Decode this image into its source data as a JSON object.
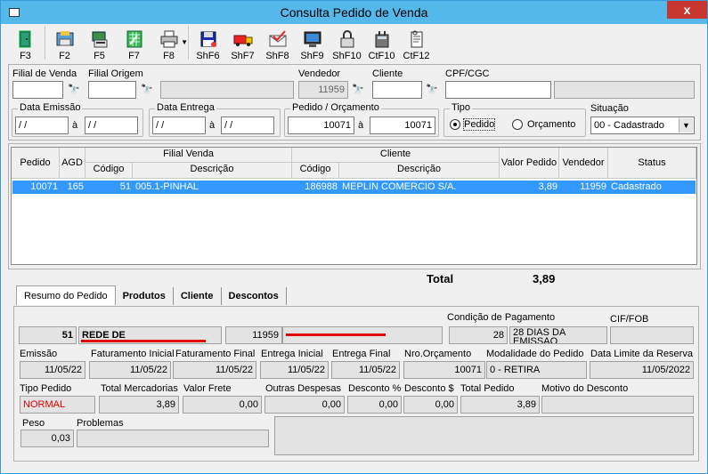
{
  "window": {
    "title": "Consulta Pedido de Venda",
    "close": "x"
  },
  "toolbar": [
    {
      "key": "F3",
      "icon": "exit-door-icon"
    },
    {
      "key": "F2",
      "icon": "save-icon"
    },
    {
      "key": "F5",
      "icon": "copy-icon"
    },
    {
      "key": "F7",
      "icon": "spreadsheet-icon"
    },
    {
      "key": "F8",
      "icon": "printer-icon"
    },
    {
      "key": "ShF6",
      "icon": "floppy-icon"
    },
    {
      "key": "ShF7",
      "icon": "truck-icon"
    },
    {
      "key": "ShF8",
      "icon": "email-check-icon"
    },
    {
      "key": "ShF9",
      "icon": "monitor-icon"
    },
    {
      "key": "ShF10",
      "icon": "lock-icon"
    },
    {
      "key": "CtF10",
      "icon": "calculator-icon"
    },
    {
      "key": "CtF12",
      "icon": "document-icon"
    }
  ],
  "filters": {
    "filial_venda": {
      "label": "Filial de Venda",
      "value": ""
    },
    "filial_origem": {
      "label": "Filial Origem",
      "value": "",
      "desc": ""
    },
    "vendedor": {
      "label": "Vendedor",
      "value": "11959"
    },
    "cliente": {
      "label": "Cliente",
      "value": ""
    },
    "cpf": {
      "label": "CPF/CGC",
      "value": "",
      "extra": ""
    },
    "data_emissao": {
      "label": "Data Emissão",
      "from": "/ /",
      "to": "/ /",
      "sep": "à"
    },
    "data_entrega": {
      "label": "Data Entrega",
      "from": "/ /",
      "to": "/ /",
      "sep": "à"
    },
    "pedido": {
      "label": "Pedido / Orçamento",
      "from": "10071",
      "to": "10071",
      "sep": "à"
    },
    "tipo": {
      "label": "Tipo",
      "opt1": "Pedido",
      "opt2": "Orçamento"
    },
    "situacao": {
      "label": "Situação",
      "value": "00 - Cadastrado"
    }
  },
  "grid": {
    "headers": {
      "pedido": "Pedido",
      "agd": "AGD",
      "filial": "Filial Venda",
      "codigo": "Código",
      "descricao": "Descrição",
      "cliente": "Cliente",
      "codigo2": "Código",
      "descricao2": "Descrição",
      "valor": "Valor Pedido",
      "vendedor": "Vendedor",
      "status": "Status"
    },
    "row": {
      "pedido": "10071",
      "agd": "165",
      "fil_cod": "51",
      "fil_desc": "005.1-PINHAL",
      "cli_cod": "186988",
      "cli_desc": "MEPLIN COMERCIO S/A.",
      "valor": "3,89",
      "vendedor": "11959",
      "status": "Cadastrado"
    }
  },
  "total": {
    "label": "Total",
    "value": "3,89"
  },
  "tabs": [
    "Resumo do Pedido",
    "Produtos",
    "Cliente",
    "Descontos"
  ],
  "summary": {
    "filial_cod": "51",
    "filial_desc": "REDE DE",
    "vendedor_cod": "11959",
    "cond_pag_label": "Condição de Pagamento",
    "cond_pag_cod": "28",
    "cond_pag_desc": "28 DIAS DA EMISSAO",
    "cif_label": "CIF/FOB",
    "cif_value": "",
    "emissao": {
      "label": "Emissão",
      "value": "11/05/22"
    },
    "fat_ini": {
      "label": "Faturamento Inicial",
      "value": "11/05/22"
    },
    "fat_fim": {
      "label": "Faturamento Final",
      "value": "11/05/22"
    },
    "ent_ini": {
      "label": "Entrega Inicial",
      "value": "11/05/22"
    },
    "ent_fim": {
      "label": "Entrega Final",
      "value": "11/05/22"
    },
    "nro_orc": {
      "label": "Nro.Orçamento",
      "value": "10071"
    },
    "modalidade": {
      "label": "Modalidade do Pedido",
      "value": "0 - RETIRA"
    },
    "data_limite": {
      "label": "Data Limite da Reserva",
      "value": "11/05/2022"
    },
    "tipo_pedido": {
      "label": "Tipo Pedido",
      "value": "NORMAL"
    },
    "total_merc": {
      "label": "Total Mercadorias",
      "value": "3,89"
    },
    "valor_frete": {
      "label": "Valor Frete",
      "value": "0,00"
    },
    "outras": {
      "label": "Outras Despesas",
      "value": "0,00"
    },
    "desc_pct": {
      "label": "Desconto %",
      "value": "0,00"
    },
    "desc_val": {
      "label": "Desconto $",
      "value": "0,00"
    },
    "total_ped": {
      "label": "Total Pedido",
      "value": "3,89"
    },
    "motivo": {
      "label": "Motivo do Desconto",
      "value": ""
    },
    "peso": {
      "label": "Peso",
      "value": "0,03"
    },
    "problemas": {
      "label": "Problemas",
      "value": ""
    }
  }
}
